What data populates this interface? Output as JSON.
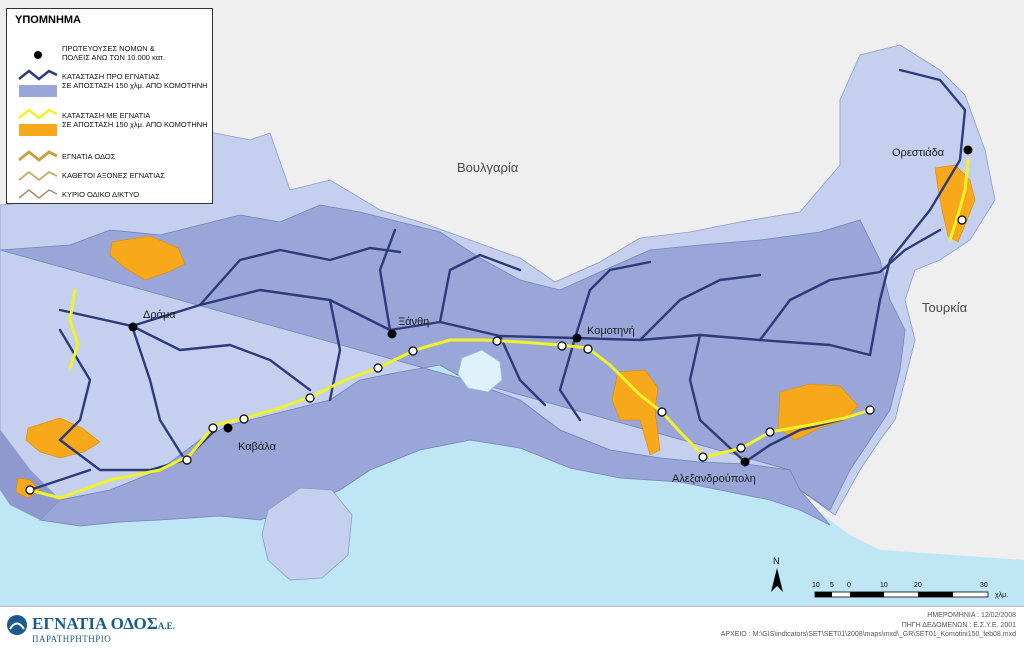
{
  "legend": {
    "title": "ΥΠΟΜΝΗΜΑ",
    "items": [
      {
        "label": "ΠΡΩΤΕΥΟΥΣΕΣ ΝΟΜΩΝ &\nΠΟΛΕΙΣ ΑΝΩ ΤΩΝ 10.000 κατ.",
        "symbol": "city-dot",
        "color": "#000000"
      },
      {
        "label": "ΚΑΤΑΣΤΑΣΗ ΠΡΟ ΕΓΝΑΤΙΑΣ\nΣΕ ΑΠΟΣΤΑΣΗ 150 χλμ. ΑΠΟ ΚΟΜΟΤΗΝΗ",
        "symbol": "line-and-area",
        "color": "#2f3a7a",
        "fill": "#9aa6d8"
      },
      {
        "label": "ΚΑΤΑΣΤΑΣΗ ΜΕ ΕΓΝΑΤΙΑ\nΣΕ ΑΠΟΣΤΑΣΗ 150 χλμ. ΑΠΟ ΚΟΜΟΤΗΝΗ",
        "symbol": "line-and-area",
        "color": "#f2f22a",
        "fill": "#f7a81b"
      },
      {
        "label": "ΕΓΝΑΤΙΑ ΟΔΟΣ",
        "symbol": "road-egnatia",
        "color": "#c9a048"
      },
      {
        "label": "ΚΑΘΕΤΟΙ ΑΞΟΝΕΣ ΕΓΝΑΤΙΑΣ",
        "symbol": "road-vertical",
        "color": "#c2b070"
      },
      {
        "label": "ΚΥΡΙΟ ΟΔΙΚΟ ΔΙΚΤΥΟ",
        "symbol": "road-main",
        "color": "#b08a70"
      }
    ]
  },
  "map": {
    "countries": {
      "bulgaria": "Βουλγαρία",
      "turkey": "Τουρκία"
    },
    "cities": {
      "drama": "Δράμα",
      "xanthi": "Ξάνθη",
      "kavala": "Καβάλα",
      "komotini": "Κομοτηνή",
      "alexandroupoli": "Αλεξανδρούπολη",
      "orestiada": "Ορεστιάδα"
    },
    "north_label": "N",
    "scale_ticks": [
      "10",
      "5",
      "0",
      "10",
      "20",
      "30"
    ],
    "scale_unit": "χλμ.",
    "colors": {
      "sea": "#bfe6f4",
      "pre_egnatia_zone": "#9aa6d8",
      "outer_zone": "#c5d0ee",
      "with_egnatia_zone": "#f7a81b",
      "egnatia": "#f2f22a",
      "roads": "#2f3a7a",
      "neighbor_land": "#efefef"
    }
  },
  "footer": {
    "logo_name": "ΕΓΝΑΤΙΑ ΟΔΟΣ",
    "logo_suffix": "Α.Ε.",
    "logo_sub": "ΠΑΡΑΤΗΡΗΤΗΡΙΟ",
    "date": "ΗΜΕΡΟΜΗΝΙΑ : 12/02/2008",
    "source": "ΠΗΓΗ ΔΕΔΟΜΕΝΩΝ : Ε.Σ.Υ.Ε. 2001",
    "file": "ΑΡΧΕΙΟ : M:\\GIS\\indicators\\SET\\SET01\\2008\\maps\\mxd\\_GR\\SET01_Komotini150_feb08.mxd"
  }
}
